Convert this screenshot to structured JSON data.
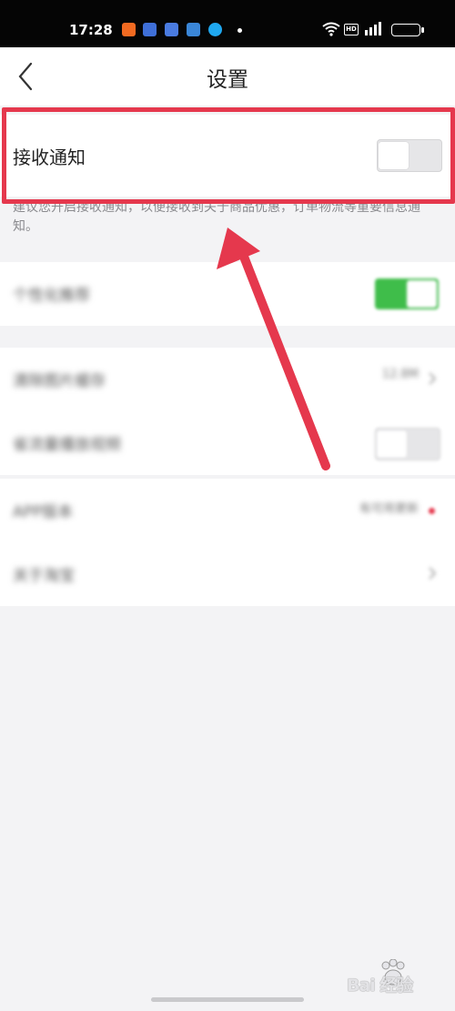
{
  "status_bar": {
    "time": "17:28",
    "app_icons": [
      {
        "name": "taobao-icon",
        "color": "#f26a21"
      },
      {
        "name": "toutiao-icon",
        "color": "#3f6fd8"
      },
      {
        "name": "message-icon",
        "color": "#4a7be0"
      },
      {
        "name": "mail-icon",
        "color": "#3a86d8"
      },
      {
        "name": "qq-icon",
        "color": "#1fa8f0"
      }
    ],
    "hd_badge": "HD"
  },
  "header": {
    "title": "设置",
    "back_icon": "chevron-left-icon"
  },
  "notification_setting": {
    "label": "接收通知",
    "enabled": false,
    "description": "建议您开启接收通知，以便接收到关于商品优惠，订单物流等重要信息通知。"
  },
  "blurred_rows": [
    {
      "label": "个性化推荐",
      "control": "toggle",
      "enabled": true
    },
    {
      "label": "清除图片缓存",
      "value": "12.8M",
      "control": "chevron"
    },
    {
      "label": "省流量播放视频",
      "control": "toggle",
      "enabled": false
    },
    {
      "label": "APP版本",
      "value": "有可用更新",
      "control": "dot"
    },
    {
      "label": "关于淘宝",
      "control": "chevron"
    }
  ],
  "colors": {
    "annotation_red": "#e5384d",
    "toggle_on": "#3fbd4a",
    "background": "#f3f3f5"
  },
  "watermark": {
    "text": "Bai 经验"
  }
}
